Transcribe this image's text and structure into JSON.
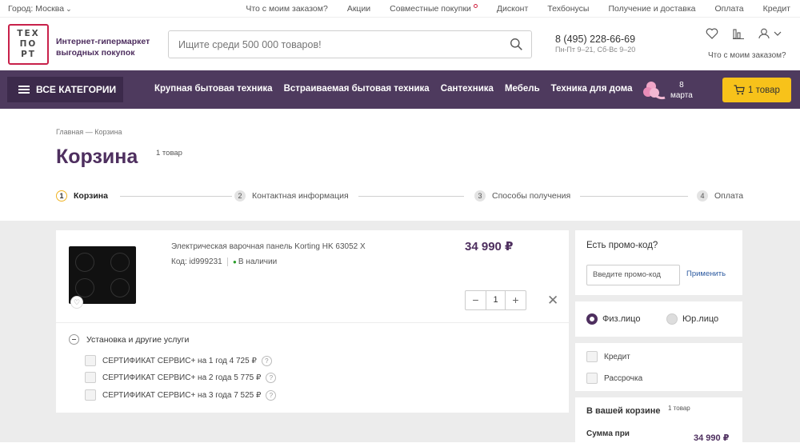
{
  "topbar": {
    "city": "Город: Москва",
    "links": [
      "Что с моим заказом?",
      "Акции",
      "Совместные покупки",
      "Дисконт",
      "Техбонусы",
      "Получение и доставка",
      "Оплата",
      "Кредит"
    ]
  },
  "header": {
    "logo_lines": [
      "ТЕХ",
      "ПО",
      "РТ"
    ],
    "tagline_1": "Интернет-гипермаркет",
    "tagline_2": "выгодных покупок",
    "search_placeholder": "Ищите среди 500 000 товаров!",
    "phone": "8 (495) 228-66-69",
    "hours": "Пн-Пт 9–21, Сб-Вс 9–20",
    "track_label": "Что с моим заказом?"
  },
  "nav": {
    "all_categories": "ВСЕ КАТЕГОРИИ",
    "links": [
      "Крупная бытовая техника",
      "Встраиваемая бытовая техника",
      "Сантехника",
      "Мебель",
      "Техника для дома"
    ],
    "promo_line1": "8",
    "promo_line2": "марта",
    "cart_label": "1 товар"
  },
  "page": {
    "breadcrumb": "Главная — Корзина",
    "title": "Корзина",
    "count": "1 товар"
  },
  "steps": [
    {
      "num": "1",
      "label": "Корзина"
    },
    {
      "num": "2",
      "label": "Контактная информация"
    },
    {
      "num": "3",
      "label": "Способы получения"
    },
    {
      "num": "4",
      "label": "Оплата"
    }
  ],
  "product": {
    "name": "Электрическая варочная панель Korting HK 63052 X",
    "code": "Код: id999231",
    "stock": "В наличии",
    "price": "34 990 ₽",
    "qty": "1",
    "minus": "−",
    "plus": "+",
    "remove": "✕"
  },
  "services": {
    "heading": "Установка и другие услуги",
    "items": [
      "СЕРТИФИКАТ СЕРВИС+ на 1 год 4 725 ₽",
      "СЕРТИФИКАТ СЕРВИС+ на 2 года 5 775 ₽",
      "СЕРТИФИКАТ СЕРВИС+ на 3 года 7 525 ₽"
    ]
  },
  "promo": {
    "title": "Есть промо-код?",
    "placeholder": "Введите промо-код",
    "apply": "Применить"
  },
  "person": {
    "physical": "Физ.лицо",
    "legal": "Юр.лицо"
  },
  "payment": {
    "credit": "Кредит",
    "installment": "Рассрочка"
  },
  "summary": {
    "title": "В вашей корзине",
    "count": "1 товар",
    "sum_label": "Сумма при",
    "sum_value": "34 990 ₽"
  }
}
